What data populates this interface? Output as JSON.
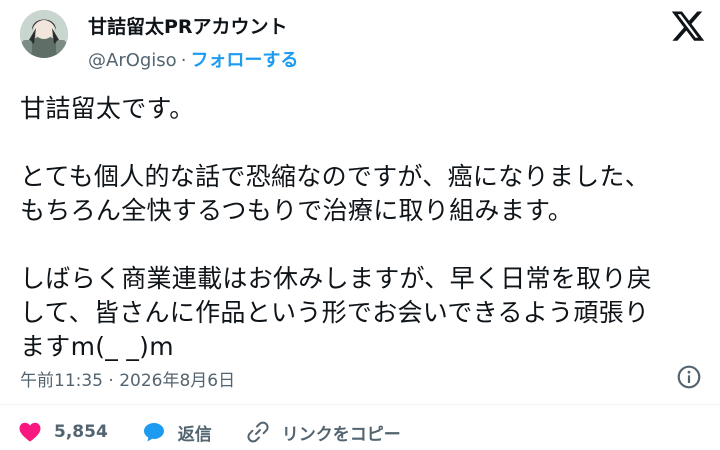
{
  "header": {
    "display_name": "甘詰留太PRアカウント",
    "handle": "@ArOgiso",
    "separator": "·",
    "follow_label": "フォローする"
  },
  "tweet": {
    "text": "甘詰留太です。\n\nとても個人的な話で恐縮なのですが、癌になりました、\nもちろん全快するつもりで治療に取り組みます。\n\nしばらく商業連載はお休みしますが、早く日常を取り戻\nして、皆さんに作品という形でお会いできるよう頑張り\nますm(_ _)m",
    "timestamp": "午前11:35 · 2026年8月6日"
  },
  "actions": {
    "like_count": "5,854",
    "reply_label": "返信",
    "copy_link_label": "リンクをコピー"
  },
  "colors": {
    "like": "#f91880",
    "reply": "#1d9bf0",
    "follow": "#1d9bf0",
    "muted": "#536471"
  },
  "icons": [
    "x-logo-icon",
    "info-icon",
    "heart-icon",
    "reply-bubble-icon",
    "link-icon"
  ]
}
